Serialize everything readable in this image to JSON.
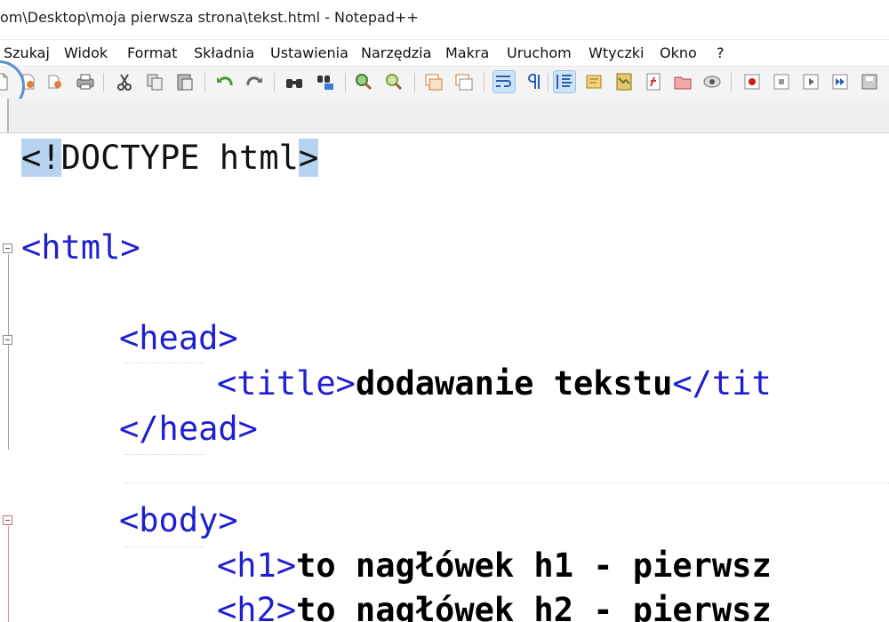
{
  "window": {
    "title": "om\\Desktop\\moja pierwsza strona\\tekst.html - Notepad++"
  },
  "menu": [
    "Szukaj",
    "Widok",
    "Format",
    "Składnia",
    "Ustawienia",
    "Narzędzia",
    "Makra",
    "Uruchom",
    "Wtyczki",
    "Okno",
    "?"
  ],
  "toolbar": {
    "icons": [
      "new-file-icon",
      "open-file-icon",
      "save-icon",
      "save-all-icon",
      "print-icon",
      "cut-icon",
      "copy-icon",
      "paste-icon",
      "undo-icon",
      "redo-icon",
      "find-icon",
      "replace-icon",
      "zoom-in-icon",
      "zoom-out-icon",
      "sync-vertical-icon",
      "sync-horizontal-icon",
      "word-wrap-icon",
      "show-all-chars-icon",
      "indent-guide-icon",
      "udl-icon",
      "doc-map-icon",
      "function-list-icon",
      "folder-workspace-icon",
      "monitoring-icon",
      "record-macro-icon",
      "stop-macro-icon",
      "play-macro-icon",
      "run-macro-multiple-icon",
      "save-macro-icon"
    ],
    "active": [
      "word-wrap-icon",
      "indent-guide-icon"
    ]
  },
  "editor": {
    "lines": {
      "l1_open": "<!",
      "l1_mid": "DOCTYPE html",
      "l1_close": ">",
      "l2": "<html>",
      "l3": "<head>",
      "l4_open": "<title>",
      "l4_text": "dodawanie tekstu",
      "l4_close": "</tit",
      "l5": "</head>",
      "l6": "<body>",
      "l7_open": "<h1>",
      "l7_text": "to nagłówek h1 - pierwsz",
      "l8_open": "<h2>",
      "l8_text": "to nagłówek h2 - pierwsz"
    }
  },
  "colors": {
    "tag": "#1f1fcf",
    "text": "#000000",
    "selection": "#b7d3ef",
    "toolbar_active": "#cfe3f7"
  }
}
